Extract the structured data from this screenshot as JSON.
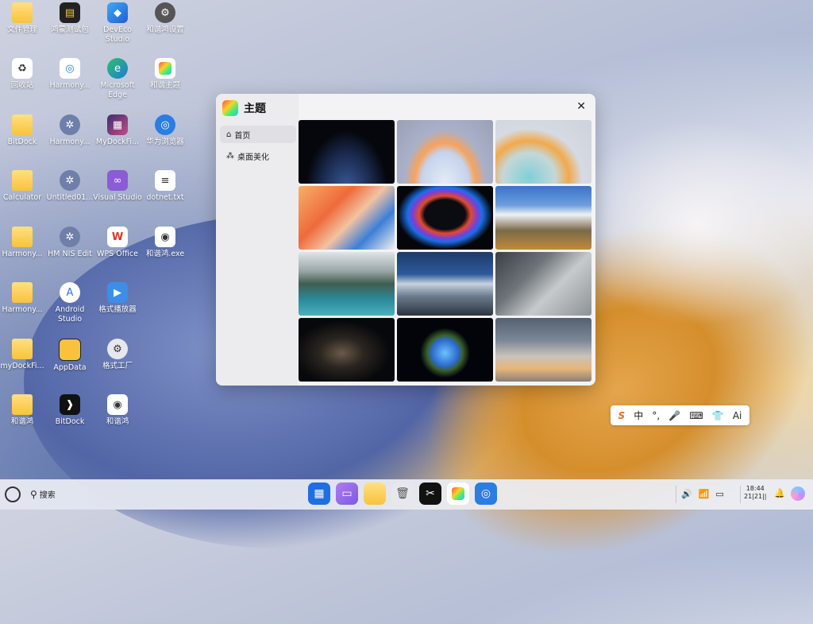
{
  "desktop_icons": [
    {
      "label": "文件管理"
    },
    {
      "label": "鸿蒙测试包"
    },
    {
      "label": "DevEco Studio"
    },
    {
      "label": "和谐鸿设置"
    },
    {
      "label": "回收站"
    },
    {
      "label": "Harmony..."
    },
    {
      "label": "Microsoft Edge"
    },
    {
      "label": "和谐主题"
    },
    {
      "label": "BitDock"
    },
    {
      "label": "Harmony..."
    },
    {
      "label": "MyDockFi..."
    },
    {
      "label": "华为浏览器"
    },
    {
      "label": "Calculator"
    },
    {
      "label": "Untitled01..."
    },
    {
      "label": "Visual Studio"
    },
    {
      "label": "dotnet.txt"
    },
    {
      "label": "Harmony..."
    },
    {
      "label": "HM NIS Edit"
    },
    {
      "label": "WPS Office"
    },
    {
      "label": "和谐鸿.exe"
    },
    {
      "label": "Harmony..."
    },
    {
      "label": "Android Studio"
    },
    {
      "label": "格式播放器"
    },
    {
      "label": "myDockFi..."
    },
    {
      "label": "AppData"
    },
    {
      "label": "格式工厂"
    },
    {
      "label": "和谐鸿"
    },
    {
      "label": "BitDock"
    },
    {
      "label": "和谐鸿"
    }
  ],
  "theme_window": {
    "title": "主题",
    "close": "✕",
    "nav": [
      {
        "label": "首页",
        "icon": "home-icon"
      },
      {
        "label": "桌面美化",
        "icon": "grid-icon"
      }
    ],
    "wallpapers": [
      "dark-planet",
      "pastel-sphere",
      "glass-sphere",
      "colorful-waves",
      "neon-sphere",
      "snowy-mountains",
      "mountain-lake",
      "sea-of-clouds",
      "misty-cliff",
      "milky-way",
      "earth-night",
      "city-fog"
    ]
  },
  "ime_toolbar": {
    "logo": "S",
    "items": [
      "中",
      "°,",
      "🎤",
      "⌨",
      "👕",
      "Ai"
    ]
  },
  "taskbar": {
    "search_label": "搜索",
    "dock": [
      "apps-icon",
      "gallery-icon",
      "folder-icon",
      "trash-icon",
      "capcut-icon",
      "theme-icon",
      "browser-icon"
    ],
    "tray": [
      "🔊",
      "📶",
      "▭"
    ],
    "time": "18:44",
    "date": "21|21||"
  }
}
